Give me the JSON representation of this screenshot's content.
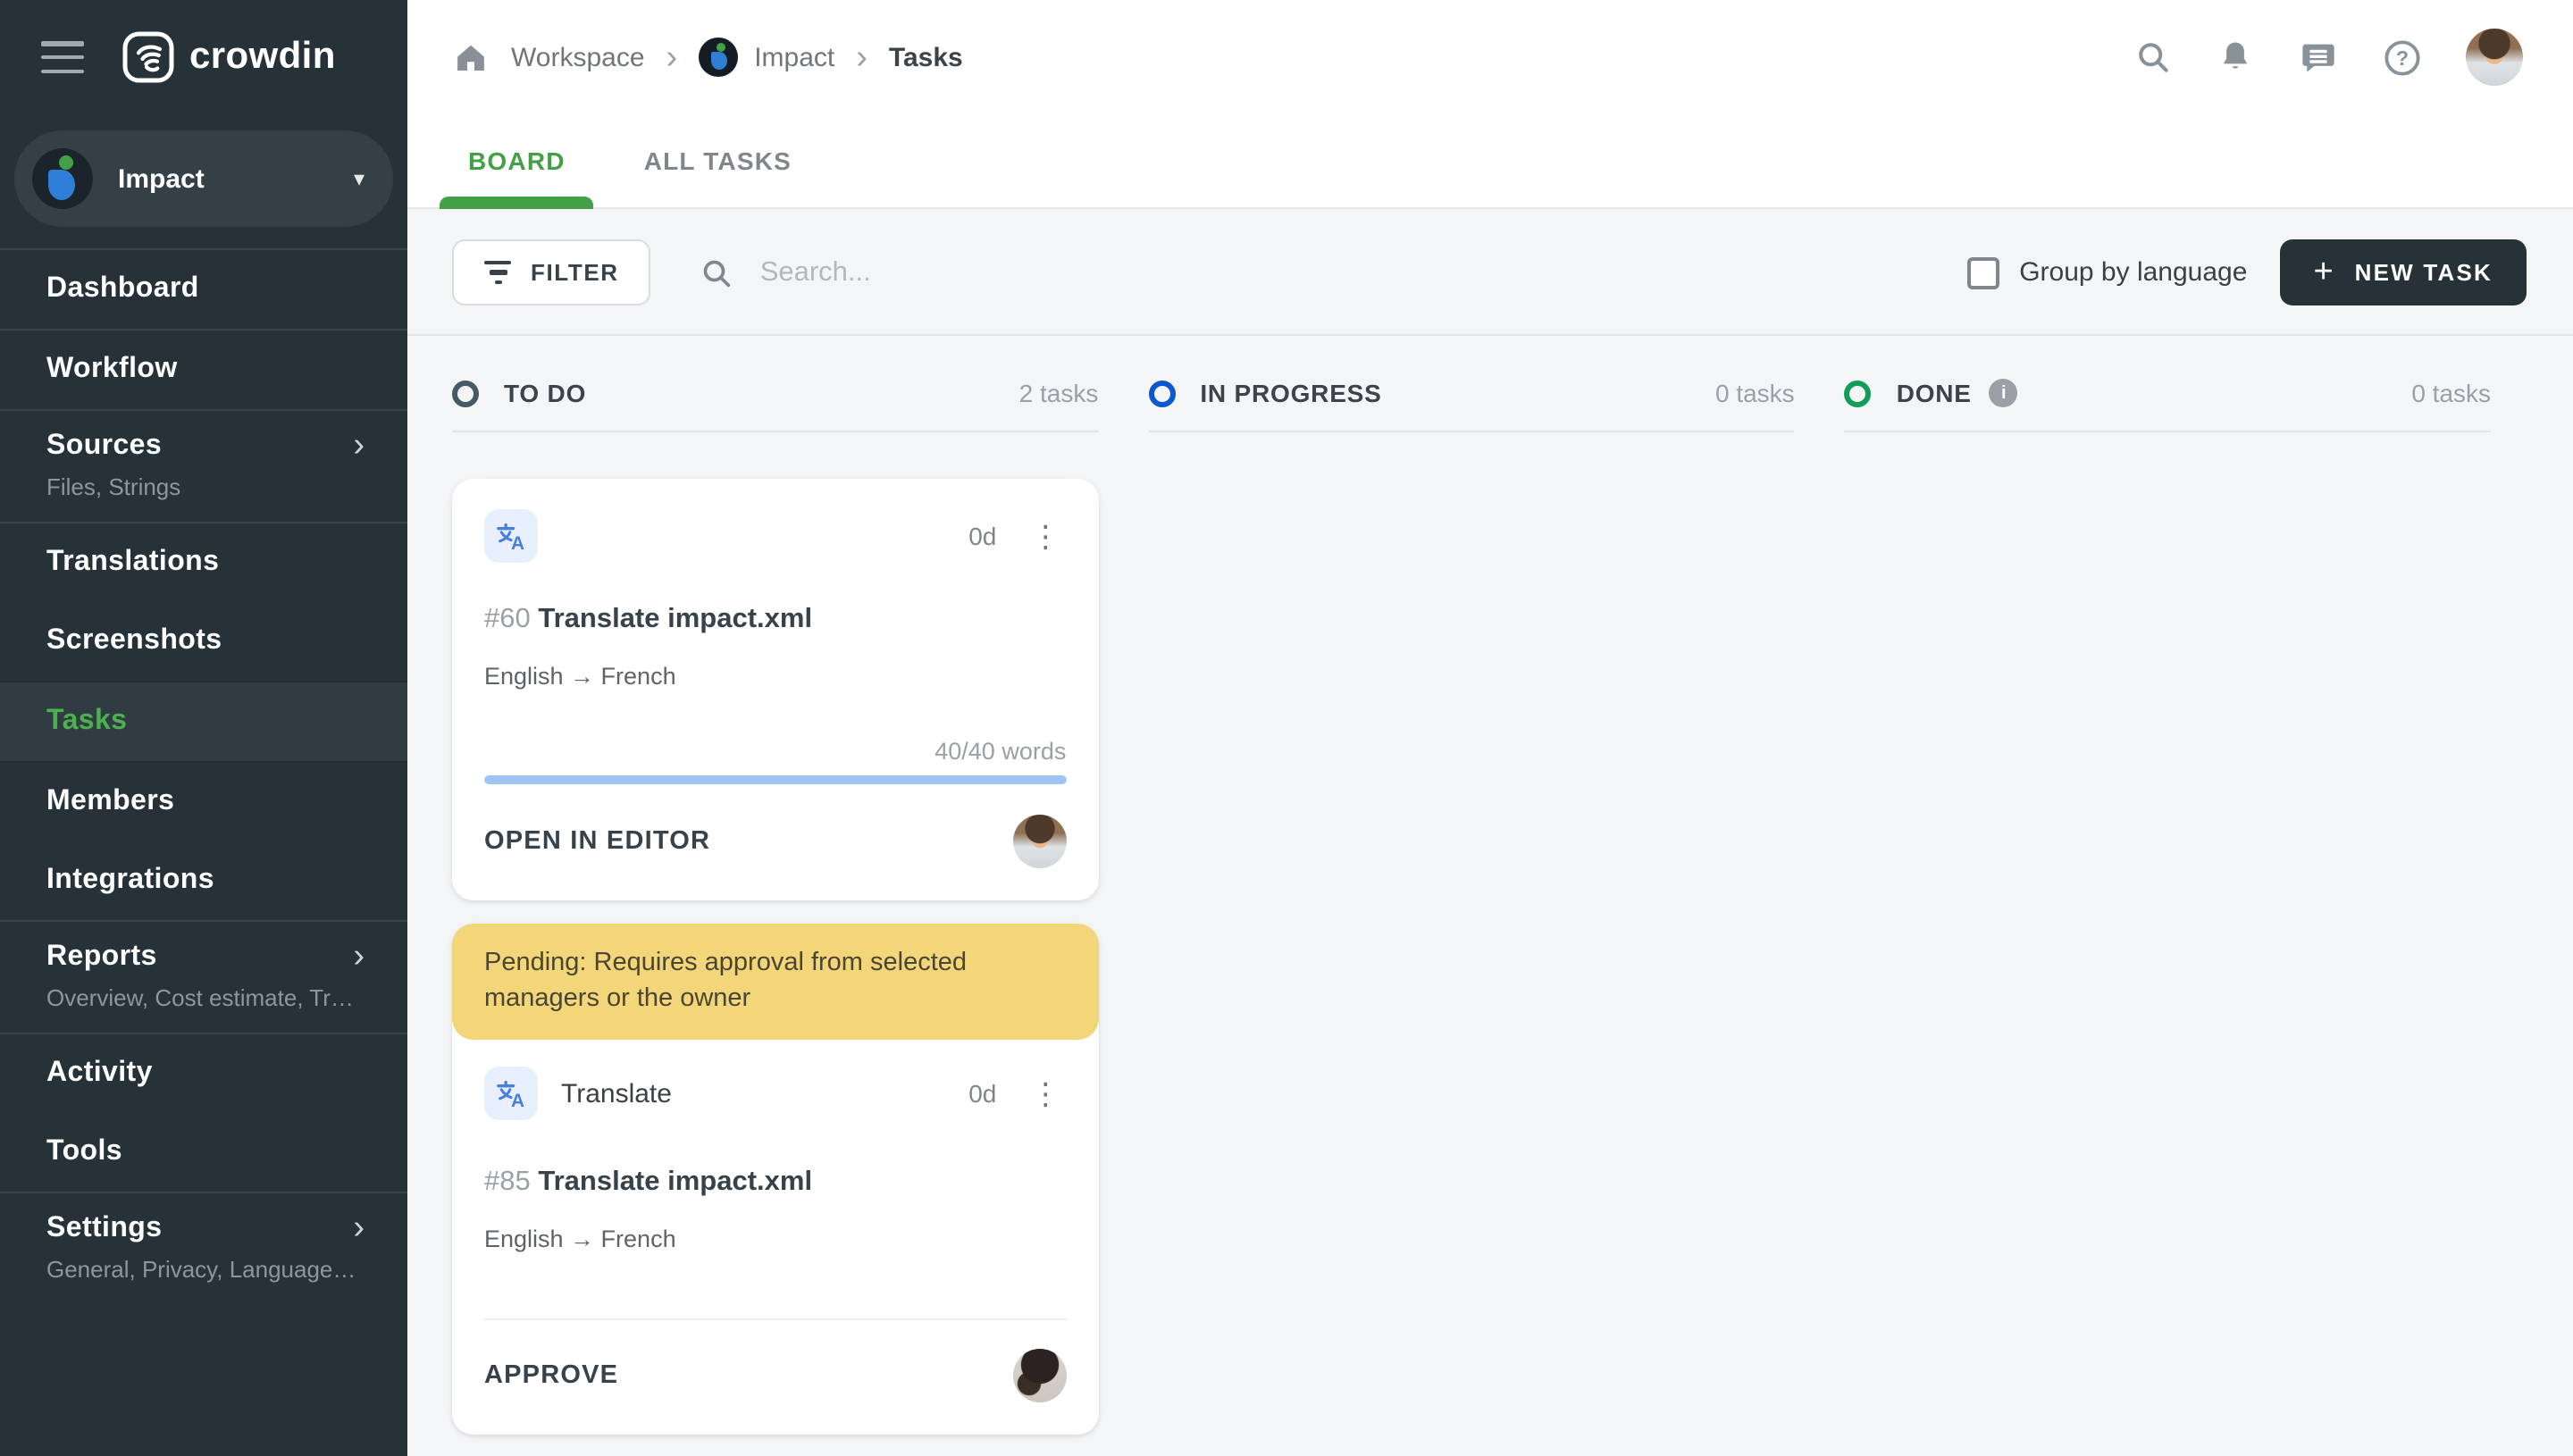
{
  "app": {
    "brand": "crowdin"
  },
  "colors": {
    "sidebar-bg": "#263238",
    "sidebar-active-green": "#4caf50",
    "accent-green": "#43a047",
    "content-bg": "#f4f5f7",
    "dark-button": "#263238",
    "banner-yellow": "#f2d679",
    "progress-blue": "#9ec3f5",
    "todo-circle": "#455a64",
    "inprogress-circle": "#0b57d0",
    "done-circle": "#0f9d58",
    "task-icon-bg": "#e8f0fe",
    "task-icon-blue": "#4a7fe0"
  },
  "sidebar": {
    "project_name": "Impact",
    "items": [
      {
        "label": "Dashboard"
      },
      {
        "label": "Workflow"
      },
      {
        "label": "Sources",
        "subtitle": "Files, Strings"
      },
      {
        "label": "Translations"
      },
      {
        "label": "Screenshots"
      },
      {
        "label": "Tasks"
      },
      {
        "label": "Members"
      },
      {
        "label": "Integrations"
      },
      {
        "label": "Reports",
        "subtitle": "Overview, Cost estimate, Transl…"
      },
      {
        "label": "Activity"
      },
      {
        "label": "Tools"
      },
      {
        "label": "Settings",
        "subtitle": "General, Privacy, Languages, Q…"
      }
    ]
  },
  "breadcrumb": {
    "workspace": "Workspace",
    "project": "Impact",
    "page": "Tasks"
  },
  "tabs": [
    {
      "label": "BOARD"
    },
    {
      "label": "ALL TASKS"
    }
  ],
  "toolbar": {
    "filter_label": "FILTER",
    "search_placeholder": "Search...",
    "group_by_label": "Group by language",
    "group_by_checked": false,
    "new_task_label": "NEW TASK"
  },
  "board": {
    "columns": [
      {
        "name": "TO DO",
        "count": "2 tasks"
      },
      {
        "name": "IN PROGRESS",
        "count": "0 tasks"
      },
      {
        "name": "DONE",
        "count": "0 tasks"
      }
    ],
    "cards": [
      {
        "id": "#60",
        "title": "Translate impact.xml",
        "languages": "English → French",
        "due": "0d",
        "words": "40/40 words",
        "progress_pct": 100,
        "action": "OPEN IN EDITOR"
      },
      {
        "banner": "Pending: Requires approval from selected managers or the owner",
        "type_label": "Translate",
        "id": "#85",
        "title": "Translate impact.xml",
        "languages": "English → French",
        "due": "0d",
        "action": "APPROVE"
      }
    ]
  },
  "glyphs": {
    "caret_down": "▾",
    "chevron_right": "›",
    "kebab": "⋮",
    "plus": "+",
    "info": "i"
  }
}
